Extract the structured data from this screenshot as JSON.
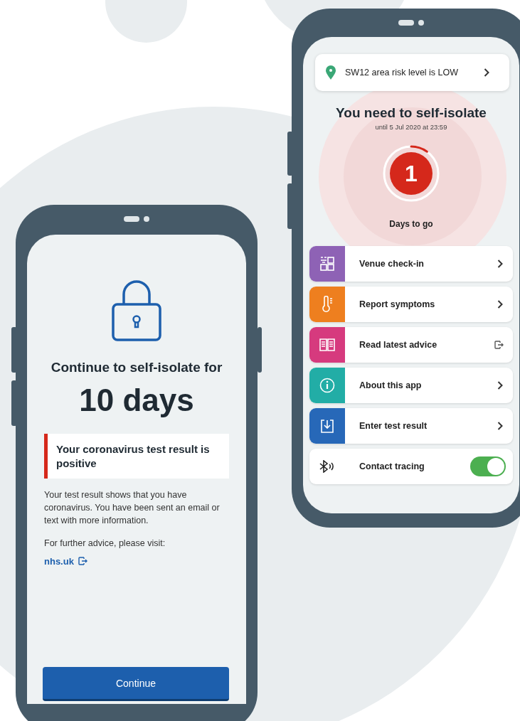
{
  "isolation_screen": {
    "title": "Continue to self-isolate for",
    "duration": "10 days",
    "callout": "Your coronavirus test result is positive",
    "body": "Your test result shows that you have coronavirus. You have been sent an email or text with more information.",
    "advice": "For further advice, please visit:",
    "link": "nhs.uk",
    "button": "Continue"
  },
  "home_screen": {
    "risk_banner": "SW12 area risk level is LOW",
    "title": "You need to self-isolate",
    "subtitle": "until 5 Jul 2020 at 23:59",
    "countdown": {
      "number": "1",
      "label": "Days to go",
      "level": 0.1
    },
    "menu": [
      {
        "label": "Venue check-in",
        "kind": "link",
        "color": "#8e62b5"
      },
      {
        "label": "Report symptoms",
        "kind": "link",
        "color": "#ee7f1f"
      },
      {
        "label": "Read latest advice",
        "kind": "external",
        "color": "#d63a7e"
      },
      {
        "label": "About this app",
        "kind": "link",
        "color": "#22ada6"
      },
      {
        "label": "Enter test result",
        "kind": "link",
        "color": "#2768b8"
      },
      {
        "label": "Contact tracing",
        "kind": "toggle",
        "on": true
      }
    ]
  }
}
